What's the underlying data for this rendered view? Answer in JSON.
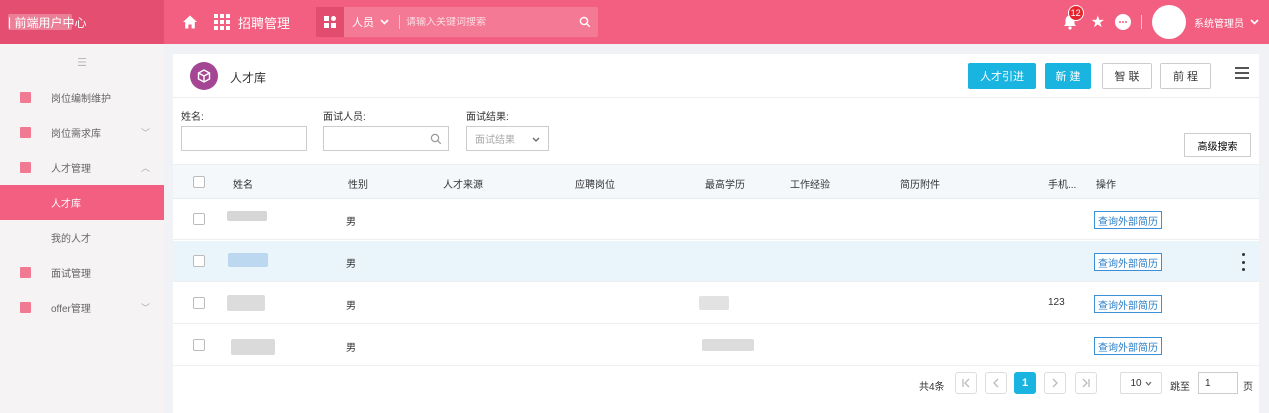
{
  "colors": {
    "brand": "#f25f80",
    "accent": "#19b4e0"
  },
  "topbar": {
    "brand_text": "前端用户中心",
    "app_title": "招聘管理",
    "search_scope": "人员",
    "search_placeholder": "请输入关键词搜索",
    "notif_count": "12",
    "username": "系统管理员"
  },
  "sidebar": {
    "items": [
      {
        "label": "岗位编制维护",
        "icon": "doc-icon"
      },
      {
        "label": "岗位需求库",
        "icon": "doc-icon"
      },
      {
        "label": "人才管理",
        "icon": "doc-icon",
        "expanded": true,
        "children": [
          {
            "label": "人才库",
            "active": true
          },
          {
            "label": "我的人才"
          }
        ]
      },
      {
        "label": "面试管理",
        "icon": "doc-icon"
      },
      {
        "label": "offer管理",
        "icon": "doc-icon"
      }
    ]
  },
  "header": {
    "title": "人才库",
    "buttons": {
      "talent_import": "人才引进",
      "new": "新 建",
      "zhilian": "智 联",
      "qiancheng": "前 程"
    }
  },
  "filters": {
    "name_label": "姓名:",
    "interviewer_label": "面试人员:",
    "result_label": "面试结果:",
    "result_placeholder": "面试结果",
    "advanced": "高级搜索"
  },
  "table": {
    "columns": [
      "姓名",
      "性别",
      "人才来源",
      "应聘岗位",
      "最高学历",
      "工作经验",
      "简历附件",
      "手机...",
      "操作"
    ],
    "rows": [
      {
        "gender": "男",
        "phone": "",
        "action": "查询外部简历"
      },
      {
        "gender": "男",
        "phone": "",
        "action": "查询外部简历",
        "highlighted": true
      },
      {
        "gender": "男",
        "phone": "123",
        "action": "查询外部简历"
      },
      {
        "gender": "男",
        "phone": "",
        "action": "查询外部简历"
      }
    ]
  },
  "pagination": {
    "total": "共4条",
    "current_page": "1",
    "page_size": "10",
    "jump_label": "跳至",
    "jump_value": "1",
    "page_unit": "页"
  }
}
